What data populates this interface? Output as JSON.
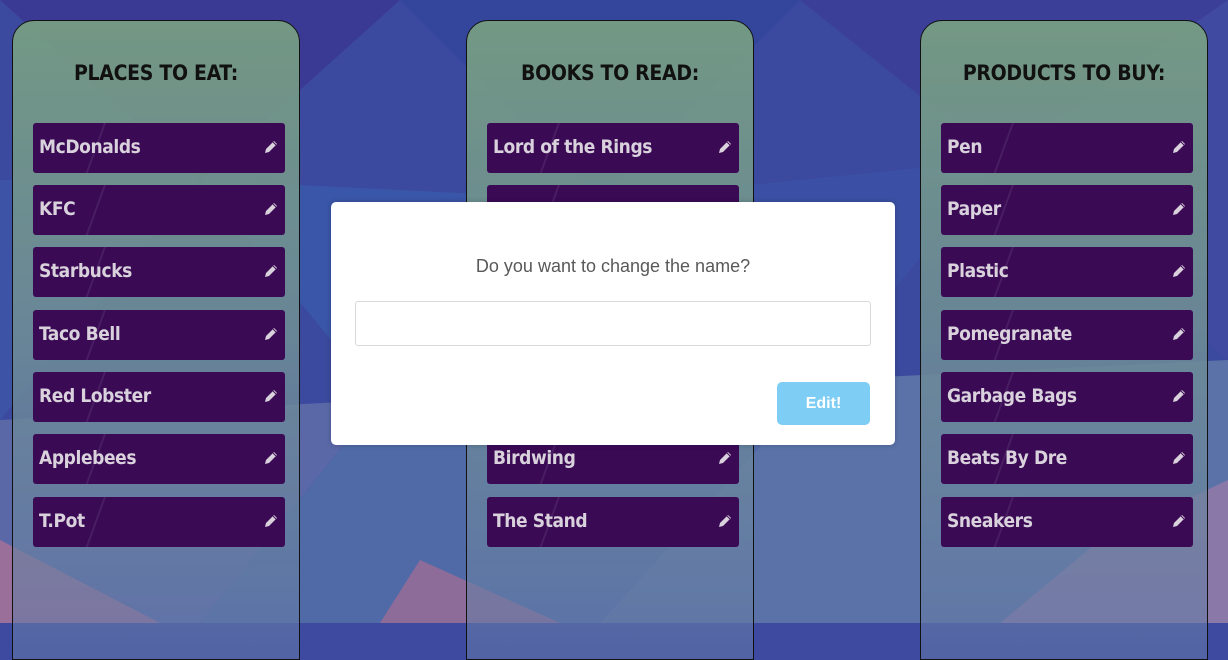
{
  "columns": [
    {
      "title": "PLACES TO EAT:",
      "items": [
        "McDonalds",
        "KFC",
        "Starbucks",
        "Taco Bell",
        "Red Lobster",
        "Applebees",
        "T.Pot"
      ]
    },
    {
      "title": "BOOKS TO READ:",
      "items": [
        "Lord of the Rings",
        "",
        "",
        "",
        "",
        "Birdwing",
        "The Stand"
      ]
    },
    {
      "title": "PRODUCTS TO BUY:",
      "items": [
        "Pen",
        "Paper",
        "Plastic",
        "Pomegranate",
        "Garbage Bags",
        "Beats By Dre",
        "Sneakers"
      ]
    }
  ],
  "modal": {
    "title": "Do you want to change the name?",
    "input_value": "",
    "button_label": "Edit!"
  },
  "colors": {
    "item_bg": "#3a0a55",
    "item_text": "#d9d2dc",
    "button_bg": "#7ecdf4"
  },
  "icons": {
    "item_edit": "pencil-icon"
  }
}
